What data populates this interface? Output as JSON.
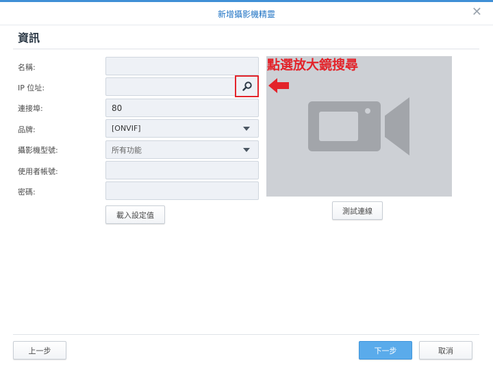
{
  "dialog": {
    "title": "新增攝影機精靈",
    "close_symbol": "✕"
  },
  "section": {
    "title": "資訊"
  },
  "form": {
    "name": {
      "label": "名稱:",
      "value": ""
    },
    "ip": {
      "label": "IP 位址:",
      "value": ""
    },
    "port": {
      "label": "連接埠:",
      "value": "80"
    },
    "brand": {
      "label": "品牌:",
      "value": "[ONVIF]"
    },
    "model": {
      "label": "攝影機型號:",
      "value": "所有功能"
    },
    "username": {
      "label": "使用者帳號:",
      "value": ""
    },
    "password": {
      "label": "密碼:",
      "value": ""
    },
    "load_defaults_label": "載入設定值"
  },
  "annotation": {
    "text": "點選放大鏡搜尋",
    "color": "#e3232a"
  },
  "preview": {
    "test_button_label": "測試連線"
  },
  "footer": {
    "prev_label": "上一步",
    "next_label": "下一步",
    "cancel_label": "取消"
  },
  "icons": {
    "search": "search-icon",
    "camera": "video-camera-icon",
    "arrow": "arrow-left-icon",
    "close": "close-icon"
  },
  "colors": {
    "accent": "#3f8fd6",
    "primary_button": "#5aabeb",
    "highlight": "#e3232a",
    "preview_bg": "#cdd0d5"
  }
}
